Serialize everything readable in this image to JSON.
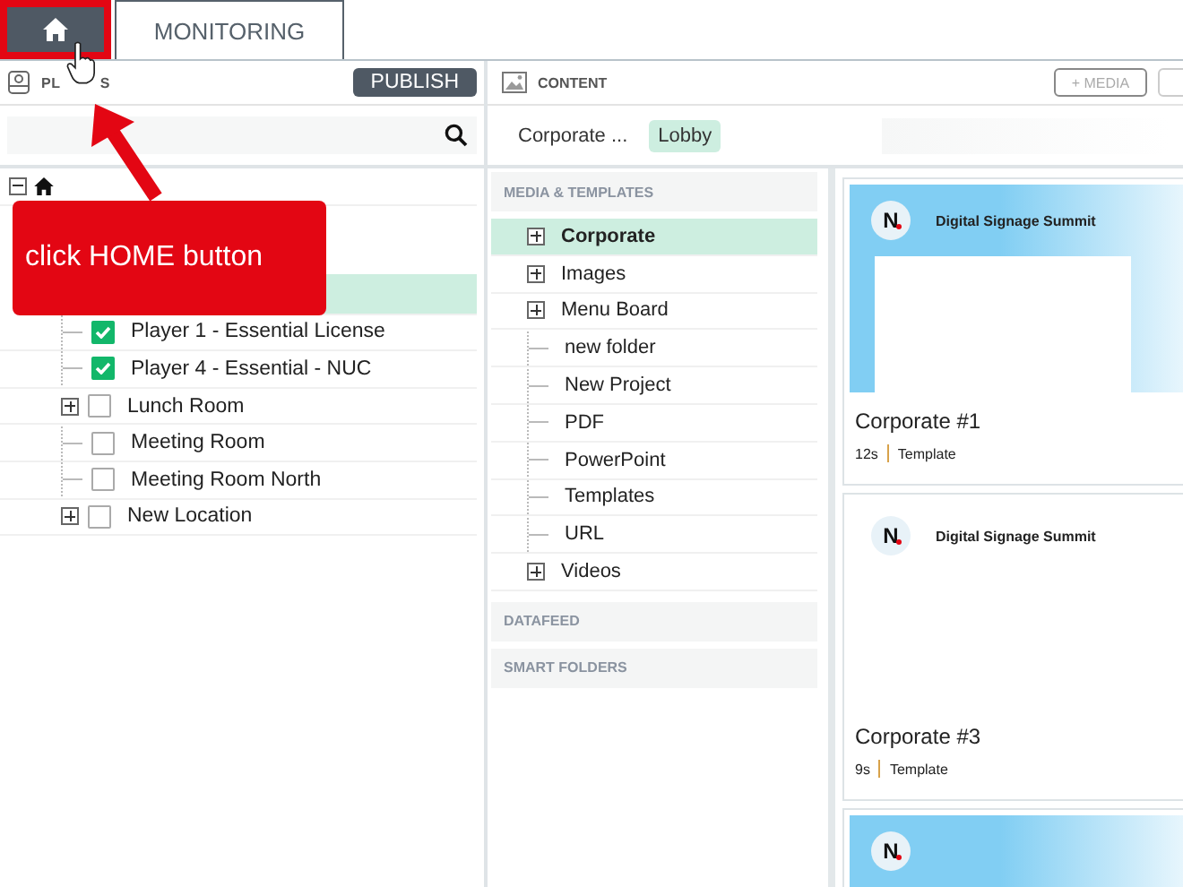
{
  "top_tabs": [
    {
      "kind": "home",
      "selected": true
    },
    {
      "kind": "text",
      "label": "MONITORING",
      "selected": false
    }
  ],
  "callout": {
    "text": "click HOME button"
  },
  "players_panel": {
    "title_visible_parts": [
      "PL",
      "S"
    ],
    "publish_button": "PUBLISH",
    "tree": {
      "kind": "home",
      "expanded": true,
      "children": [
        {
          "selected": true
        },
        {
          "label": "Player 1 - Essential License",
          "checked": true,
          "expandable": false
        },
        {
          "label": "Player 4 - Essential - NUC",
          "checked": true,
          "expandable": false
        },
        {
          "label": "Lunch Room",
          "checked": false,
          "expandable": true
        },
        {
          "label": "Meeting Room",
          "checked": false,
          "expandable": false
        },
        {
          "label": "Meeting Room North",
          "checked": false,
          "expandable": false
        },
        {
          "label": "New Location",
          "checked": false,
          "expandable": true
        }
      ]
    }
  },
  "content_panel": {
    "title": "CONTENT",
    "media_button": "+ MEDIA",
    "breadcrumb": [
      {
        "label": "Corporate ...",
        "selected": false
      },
      {
        "label": "Lobby",
        "selected": true
      }
    ],
    "sections": [
      {
        "title": "MEDIA & TEMPLATES",
        "items": [
          {
            "label": "Corporate",
            "selected": true,
            "expandable": true
          },
          {
            "label": "Images",
            "selected": false,
            "expandable": true
          },
          {
            "label": "Menu Board",
            "selected": false,
            "expandable": true
          },
          {
            "label": "new folder",
            "selected": false,
            "expandable": false
          },
          {
            "label": "New Project",
            "selected": false,
            "expandable": false
          },
          {
            "label": "PDF",
            "selected": false,
            "expandable": false
          },
          {
            "label": "PowerPoint",
            "selected": false,
            "expandable": false
          },
          {
            "label": "Templates",
            "selected": false,
            "expandable": false
          },
          {
            "label": "URL",
            "selected": false,
            "expandable": false
          },
          {
            "label": "Videos",
            "selected": false,
            "expandable": true
          }
        ]
      },
      {
        "title": "DATAFEED"
      },
      {
        "title": "SMART FOLDERS"
      }
    ],
    "cards": [
      {
        "title": "Corporate #1",
        "duration": "12s",
        "type": "Template",
        "thumbnail": {
          "kind": "gradient",
          "logo": "N",
          "heading": "Digital Signage Summit"
        }
      },
      {
        "title": "Corporate #3",
        "duration": "9s",
        "type": "Template",
        "thumbnail": {
          "kind": "plain",
          "logo": "N",
          "heading": "Digital Signage Summit"
        }
      },
      {
        "thumbnail": {
          "kind": "gradient",
          "logo": "N"
        }
      }
    ]
  }
}
